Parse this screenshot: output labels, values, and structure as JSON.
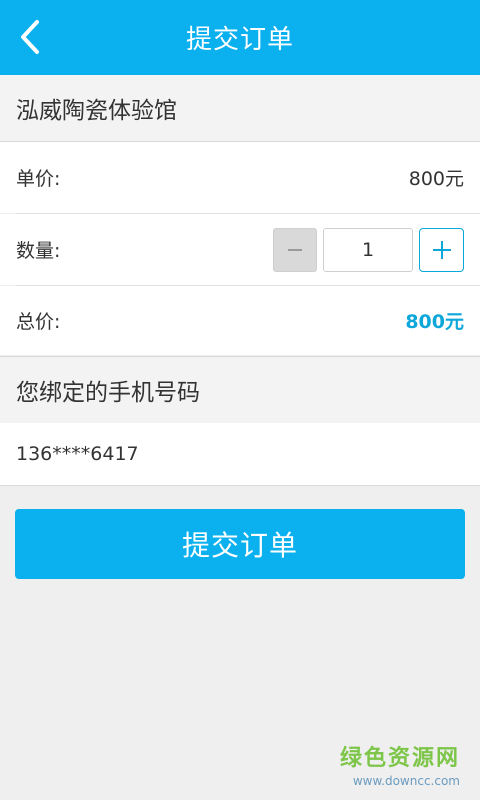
{
  "header": {
    "title": "提交订单",
    "back_icon": "chevron-left-icon",
    "background": "#0bb0ee"
  },
  "store": {
    "name": "泓威陶瓷体验馆"
  },
  "order": {
    "unit_price_label": "单价:",
    "unit_price_value": "800元",
    "quantity_label": "数量:",
    "quantity_value": "1",
    "minus_icon": "minus-icon",
    "plus_icon": "plus-icon",
    "total_label": "总价:",
    "total_value": "800元",
    "accent_color": "#0ea7d9"
  },
  "phone": {
    "section_title": "您绑定的手机号码",
    "number": "136****6417"
  },
  "submit": {
    "label": "提交订单"
  },
  "watermark": {
    "text": "绿色资源网",
    "url": "www.downcc.com"
  }
}
